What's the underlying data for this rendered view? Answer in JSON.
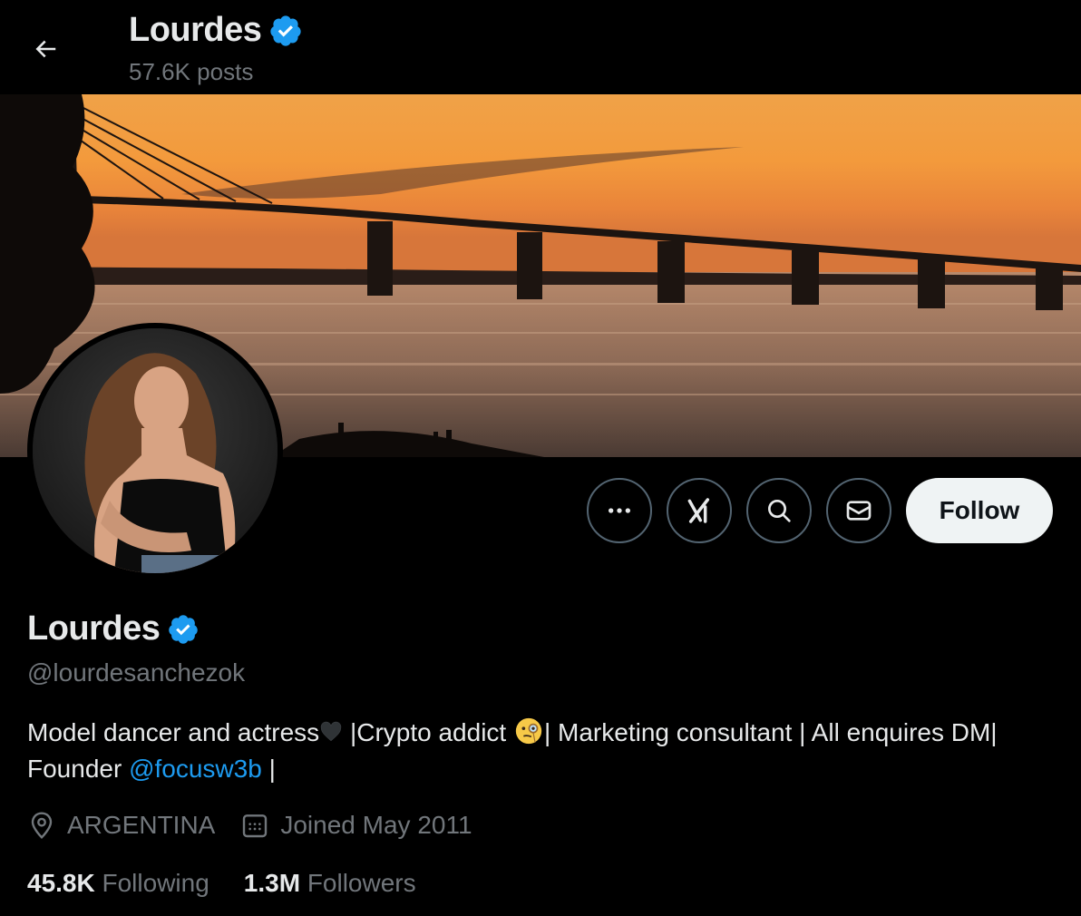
{
  "header": {
    "back_label": "Back",
    "name": "Lourdes",
    "posts_count": "57.6K posts"
  },
  "profile": {
    "display_name": "Lourdes",
    "handle": "@lourdesanchezok",
    "verified": true,
    "bio": {
      "part1": "Model dancer and actress",
      "part2": " |Crypto addict ",
      "part3": "| Marketing consultant | All enquires DM| Founder ",
      "mention": "@focusw3b",
      "part4": " |"
    },
    "location": "ARGENTINA",
    "joined": "Joined May 2011",
    "following_count": "45.8K",
    "following_label": "Following",
    "followers_count": "1.3M",
    "followers_label": "Followers"
  },
  "actions": {
    "more_icon": "more-icon",
    "grok_icon": "grok-icon",
    "search_icon": "search-icon",
    "message_icon": "envelope-icon",
    "follow_label": "Follow"
  },
  "colors": {
    "background": "#000000",
    "primary_text": "#e7e9ea",
    "secondary_text": "#71767b",
    "accent": "#1d9bf0",
    "button_border": "#536471",
    "follow_bg": "#eff3f4"
  }
}
